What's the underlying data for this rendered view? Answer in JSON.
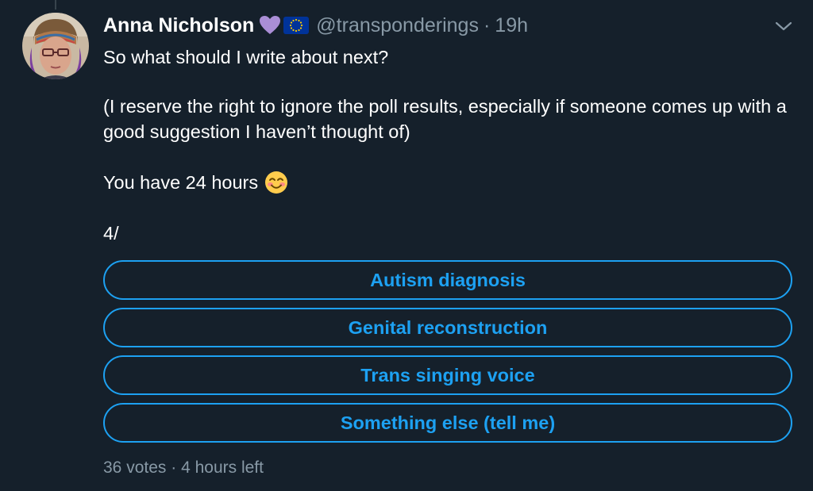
{
  "tweet": {
    "author_name": "Anna Nicholson",
    "handle": "@transponderings",
    "separator": "·",
    "time": "19h",
    "badges": [
      "purple-heart-icon",
      "eu-flag-icon"
    ],
    "text": {
      "line1": "So what should I write about next?",
      "line2": "(I reserve the right to ignore the poll results, especially if someone comes up with a good suggestion I haven’t thought of)",
      "line3": "You have 24 hours",
      "line3_emoji": "smiling-face-icon",
      "line4": "4/"
    }
  },
  "poll": {
    "options": [
      "Autism diagnosis",
      "Genital reconstruction",
      "Trans singing voice",
      "Something else (tell me)"
    ],
    "votes_label": "36 votes",
    "separator": "·",
    "time_left": "4 hours left"
  },
  "colors": {
    "background": "#15202b",
    "accent": "#1da1f2",
    "secondary_text": "#8899a6",
    "primary_text": "#ffffff"
  }
}
